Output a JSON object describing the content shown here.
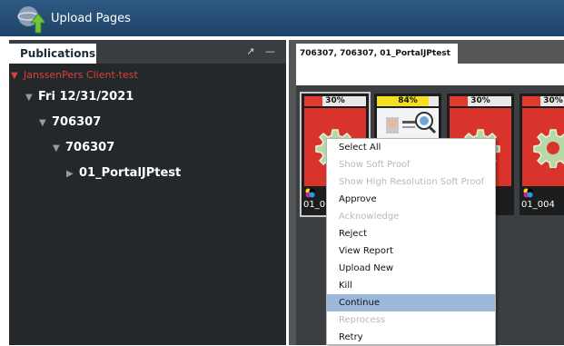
{
  "window": {
    "title": "Upload Pages"
  },
  "left_panel": {
    "tab_label": "Publications",
    "panel_buttons": [
      "↗",
      "—"
    ],
    "tree": [
      {
        "label": "JanssenPers Client-test",
        "arrow": "▼"
      },
      {
        "label": "Fri 12/31/2021",
        "arrow": "▼"
      },
      {
        "label": "706307",
        "arrow": "▼"
      },
      {
        "label": "706307",
        "arrow": "▼"
      },
      {
        "label": "01_PortalJPtest",
        "arrow": "▶"
      }
    ]
  },
  "right_panel": {
    "tab_label": "706307, 706307, 01_PortalJPtest",
    "thumbnails": [
      {
        "name": "01_0",
        "percent_label": "30%",
        "percent": 30,
        "bar_color": "#e23b2e",
        "image": "gear-icon-red"
      },
      {
        "name": "",
        "percent_label": "84%",
        "percent": 84,
        "bar_color": "#f4e11d",
        "image": "document-page-icon"
      },
      {
        "name": "",
        "percent_label": "30%",
        "percent": 30,
        "bar_color": "#e23b2e",
        "image": "gear-icon-red"
      },
      {
        "name": "01_004",
        "percent_label": "30%",
        "percent": 30,
        "bar_color": "#e23b2e",
        "image": "gear-icon-red"
      }
    ]
  },
  "context_menu": {
    "items": [
      {
        "label": "Select All",
        "enabled": true,
        "highlighted": false
      },
      {
        "label": "Show Soft Proof",
        "enabled": false,
        "highlighted": false
      },
      {
        "label": "Show High Resolution Soft Proof",
        "enabled": false,
        "highlighted": false
      },
      {
        "label": "Approve",
        "enabled": true,
        "highlighted": false
      },
      {
        "label": "Acknowledge",
        "enabled": false,
        "highlighted": false
      },
      {
        "label": "Reject",
        "enabled": true,
        "highlighted": false
      },
      {
        "label": "View Report",
        "enabled": true,
        "highlighted": false
      },
      {
        "label": "Upload New",
        "enabled": true,
        "highlighted": false
      },
      {
        "label": "Kill",
        "enabled": true,
        "highlighted": false
      },
      {
        "label": "Continue",
        "enabled": true,
        "highlighted": true
      },
      {
        "label": "Reprocess",
        "enabled": false,
        "highlighted": false
      },
      {
        "label": "Retry",
        "enabled": true,
        "highlighted": false
      }
    ]
  },
  "colors": {
    "titlebar": "#2a5078",
    "error_text": "#d9413d",
    "menu_highlight": "#9cb8da",
    "status_red": "#e23b2e",
    "status_yellow": "#f4e11d"
  }
}
